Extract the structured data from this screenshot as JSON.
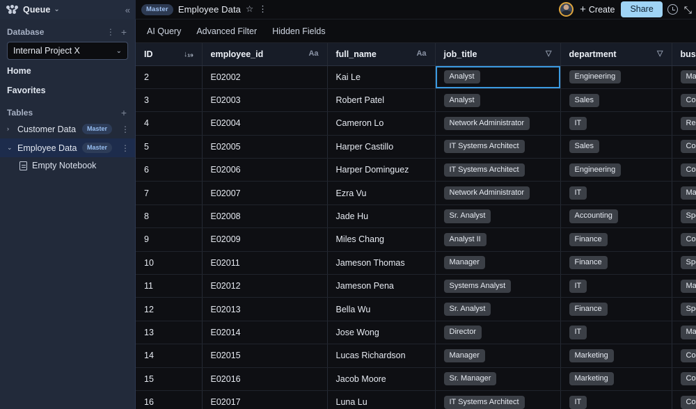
{
  "app": {
    "workspace_name": "Queue",
    "logo_icon": "nodes-logo-icon",
    "workspace_chevron": "⌄",
    "collapse_icon": "«"
  },
  "header": {
    "badge": "Master",
    "title": "Employee Data",
    "favorite_icon": "☆",
    "more_icon": "⋮",
    "create_label": "Create",
    "create_plus": "+",
    "share_label": "Share",
    "history_icon": "clock-icon",
    "expand_icon": "⤡",
    "avatar": "user-avatar"
  },
  "sidebar": {
    "database_section": {
      "title": "Database",
      "more_icon": "⋮",
      "add_icon": "+",
      "selected_value": "Internal Project X",
      "chevron": "⌄"
    },
    "links": [
      {
        "label": "Home"
      },
      {
        "label": "Favorites"
      }
    ],
    "tables_section": {
      "title": "Tables",
      "add_icon": "+"
    },
    "tables": [
      {
        "label": "Customer Data",
        "caret": "›",
        "tag": "Master",
        "kebab": "⋮",
        "expanded": false,
        "active": false
      },
      {
        "label": "Employee Data",
        "caret": "⌄",
        "tag": "Master",
        "kebab": "⋮",
        "expanded": true,
        "active": true
      }
    ],
    "children": [
      {
        "label": "Empty Notebook",
        "icon": "notebook-icon"
      }
    ]
  },
  "tabs": [
    {
      "label": "AI Query"
    },
    {
      "label": "Advanced Filter"
    },
    {
      "label": "Hidden Fields"
    }
  ],
  "table": {
    "columns": [
      {
        "key": "id",
        "label": "ID",
        "icon": "sort-asc-numeric-icon",
        "icon_glyph": "↓₁₉"
      },
      {
        "key": "employee_id",
        "label": "employee_id",
        "icon": "text-type-icon",
        "icon_glyph": "Aa"
      },
      {
        "key": "full_name",
        "label": "full_name",
        "icon": "text-type-icon",
        "icon_glyph": "Aa"
      },
      {
        "key": "job_title",
        "label": "job_title",
        "icon": "select-type-icon",
        "icon_glyph": "▽"
      },
      {
        "key": "department",
        "label": "department",
        "icon": "select-type-icon",
        "icon_glyph": "▽"
      },
      {
        "key": "busi",
        "label": "busi",
        "icon": "none",
        "icon_glyph": ""
      }
    ],
    "selected_cell": {
      "row": 0,
      "column": "job_title"
    },
    "hovered_cell": {
      "row": 3,
      "column": "job_title"
    },
    "rows": [
      {
        "id": "2",
        "employee_id": "E02002",
        "full_name": "Kai Le",
        "job_title": "Analyst",
        "department": "Engineering",
        "busi": "Mar"
      },
      {
        "id": "3",
        "employee_id": "E02003",
        "full_name": "Robert Patel",
        "job_title": "Analyst",
        "department": "Sales",
        "busi": "Cor"
      },
      {
        "id": "4",
        "employee_id": "E02004",
        "full_name": "Cameron Lo",
        "job_title": "Network Administrator",
        "department": "IT",
        "busi": "Res"
      },
      {
        "id": "5",
        "employee_id": "E02005",
        "full_name": "Harper Castillo",
        "job_title": "IT Systems Architect",
        "department": "Sales",
        "busi": "Cor"
      },
      {
        "id": "6",
        "employee_id": "E02006",
        "full_name": "Harper Dominguez",
        "job_title": "IT Systems Architect",
        "department": "Engineering",
        "busi": "Cor"
      },
      {
        "id": "7",
        "employee_id": "E02007",
        "full_name": "Ezra Vu",
        "job_title": "Network Administrator",
        "department": "IT",
        "busi": "Mar"
      },
      {
        "id": "8",
        "employee_id": "E02008",
        "full_name": "Jade Hu",
        "job_title": "Sr. Analyst",
        "department": "Accounting",
        "busi": "Spe"
      },
      {
        "id": "9",
        "employee_id": "E02009",
        "full_name": "Miles Chang",
        "job_title": "Analyst II",
        "department": "Finance",
        "busi": "Cor"
      },
      {
        "id": "10",
        "employee_id": "E02011",
        "full_name": "Jameson Thomas",
        "job_title": "Manager",
        "department": "Finance",
        "busi": "Spe"
      },
      {
        "id": "11",
        "employee_id": "E02012",
        "full_name": "Jameson Pena",
        "job_title": "Systems Analyst",
        "department": "IT",
        "busi": "Mar"
      },
      {
        "id": "12",
        "employee_id": "E02013",
        "full_name": "Bella Wu",
        "job_title": "Sr. Analyst",
        "department": "Finance",
        "busi": "Spe"
      },
      {
        "id": "13",
        "employee_id": "E02014",
        "full_name": "Jose Wong",
        "job_title": "Director",
        "department": "IT",
        "busi": "Mar"
      },
      {
        "id": "14",
        "employee_id": "E02015",
        "full_name": "Lucas Richardson",
        "job_title": "Manager",
        "department": "Marketing",
        "busi": "Cor"
      },
      {
        "id": "15",
        "employee_id": "E02016",
        "full_name": "Jacob Moore",
        "job_title": "Sr. Manager",
        "department": "Marketing",
        "busi": "Cor"
      },
      {
        "id": "16",
        "employee_id": "E02017",
        "full_name": "Luna Lu",
        "job_title": "IT Systems Architect",
        "department": "IT",
        "busi": "Cor"
      }
    ]
  },
  "colors": {
    "accent_blue": "#3b9ae1",
    "share_blue": "#9fd4f5",
    "sidebar_bg": "#222a3a",
    "grid_bg": "#0e0f13",
    "pill_bg": "#3b3f46",
    "avatar_ring": "#e0a53c"
  }
}
